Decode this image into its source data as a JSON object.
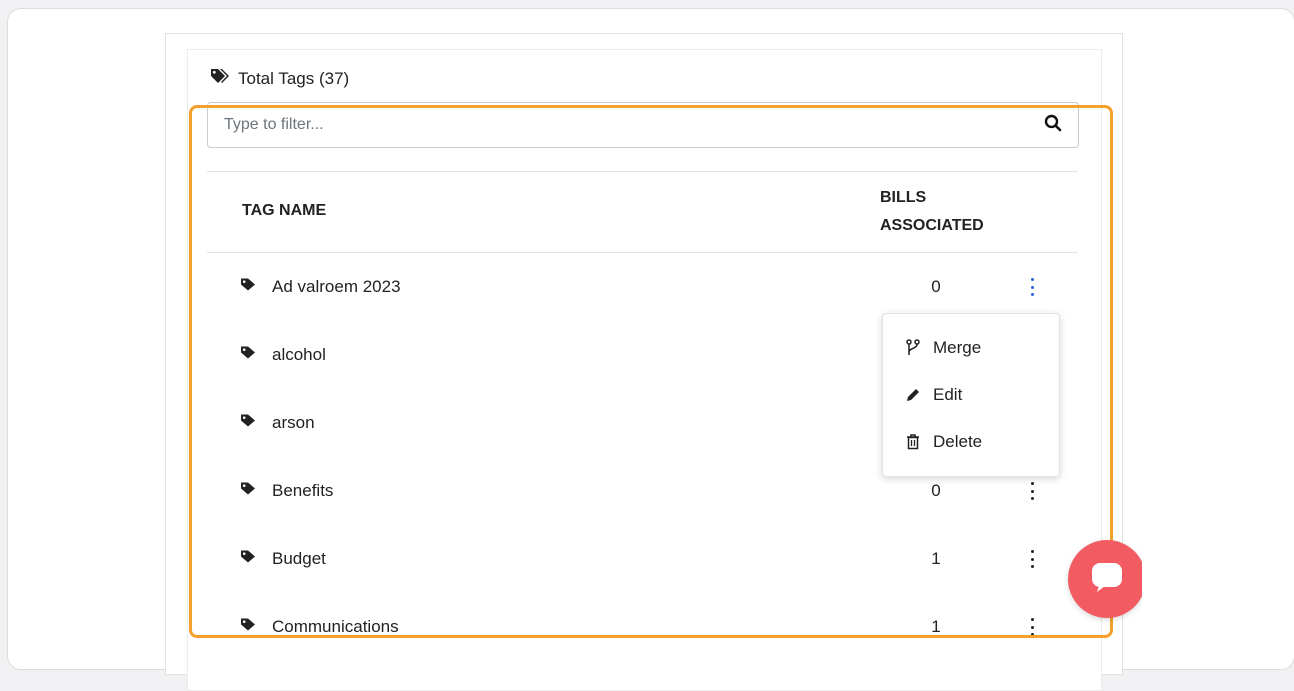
{
  "card": {
    "title": "Total Tags (37)"
  },
  "search": {
    "placeholder": "Type to filter..."
  },
  "table": {
    "headers": {
      "tag_name": "TAG NAME",
      "bills_line1": "BILLS",
      "bills_line2": "ASSOCIATED"
    },
    "rows": [
      {
        "name": "Ad valroem 2023",
        "count": "0"
      },
      {
        "name": "alcohol",
        "count": ""
      },
      {
        "name": "arson",
        "count": ""
      },
      {
        "name": "Benefits",
        "count": "0"
      },
      {
        "name": "Budget",
        "count": "1"
      },
      {
        "name": "Communications",
        "count": "1"
      }
    ]
  },
  "menu": {
    "merge": "Merge",
    "edit": "Edit",
    "delete": "Delete"
  },
  "colors": {
    "highlight": "#f5a02a",
    "kebab_active": "#2a62d6",
    "chat_bubble": "#f25b62"
  },
  "icons": [
    "tags-icon",
    "search-icon",
    "tag-icon",
    "kebab-icon",
    "merge-icon",
    "pencil-icon",
    "trash-icon",
    "chat-icon"
  ]
}
